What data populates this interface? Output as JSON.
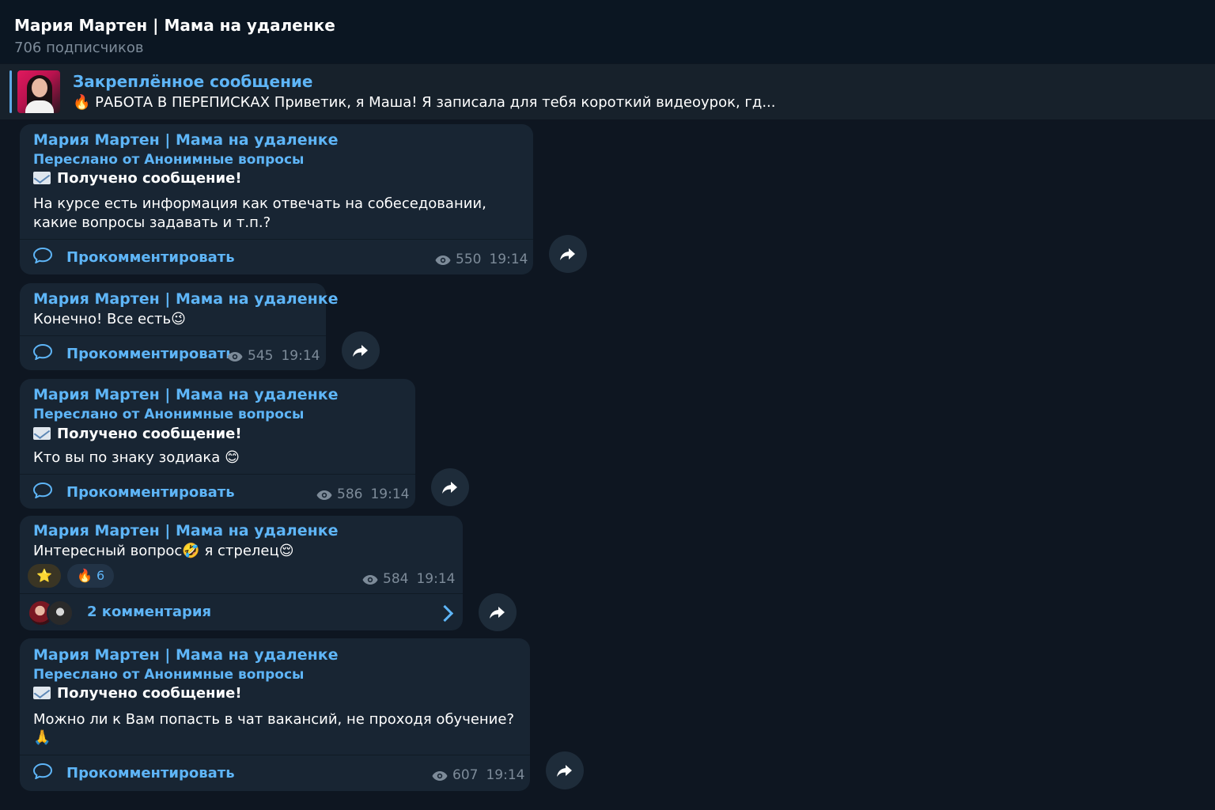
{
  "header": {
    "title": "Мария Мартен | Мама на удаленке",
    "subtitle": "706 подписчиков"
  },
  "pinned": {
    "title": "Закреплённое сообщение",
    "emoji": "🔥",
    "text": "РАБОТА В ПЕРЕПИСКАХ Приветик, я Маша! Я записала для тебя короткий видеоурок, гд..."
  },
  "messages": [
    {
      "author": "Мария Мартен | Мама на удаленке",
      "forwarded": "Переслано от Анонимные вопросы",
      "heading": "Получено сообщение!",
      "line1": "На курсе есть информация как отвечать на собеседовании,",
      "line2": "какие вопросы задавать и т.п.?",
      "comment_label": "Прокомментировать",
      "views": "550",
      "time": "19:14"
    },
    {
      "author": "Мария Мартен | Мама на удаленке",
      "line1": "Конечно! Все есть",
      "emoji1": "😉",
      "comment_label": "Прокомментировать",
      "views": "545",
      "time": "19:14"
    },
    {
      "author": "Мария Мартен | Мама на удаленке",
      "forwarded": "Переслано от Анонимные вопросы",
      "heading": "Получено сообщение!",
      "line1": "Кто вы по знаку зодиака",
      "emoji1": "😊",
      "comment_label": "Прокомментировать",
      "views": "586",
      "time": "19:14"
    },
    {
      "author": "Мария Мартен | Мама на удаленке",
      "line1a": "Интересный вопрос",
      "emoji1": "🤣",
      "line1b": "я стрелец",
      "emoji2": "😌",
      "reactions": [
        {
          "emoji": "⭐",
          "count": ""
        },
        {
          "emoji": "🔥",
          "count": "6"
        }
      ],
      "views": "584",
      "time": "19:14",
      "comments_label": "2 комментария"
    },
    {
      "author": "Мария Мартен | Мама на удаленке",
      "forwarded": "Переслано от Анонимные вопросы",
      "heading": "Получено сообщение!",
      "line1": "Можно ли к Вам попасть в чат вакансий, не проходя обучение?",
      "emoji1": "🙏",
      "comment_label": "Прокомментировать",
      "views": "607",
      "time": "19:14"
    }
  ],
  "colors": {
    "background": "#0e1621",
    "bubble": "#182533",
    "accent": "#5eb5f7",
    "muted": "#7d8b99"
  },
  "icons": [
    "comment-icon",
    "eye-icon",
    "share-icon",
    "chevron-right-icon",
    "envelope-icon"
  ]
}
